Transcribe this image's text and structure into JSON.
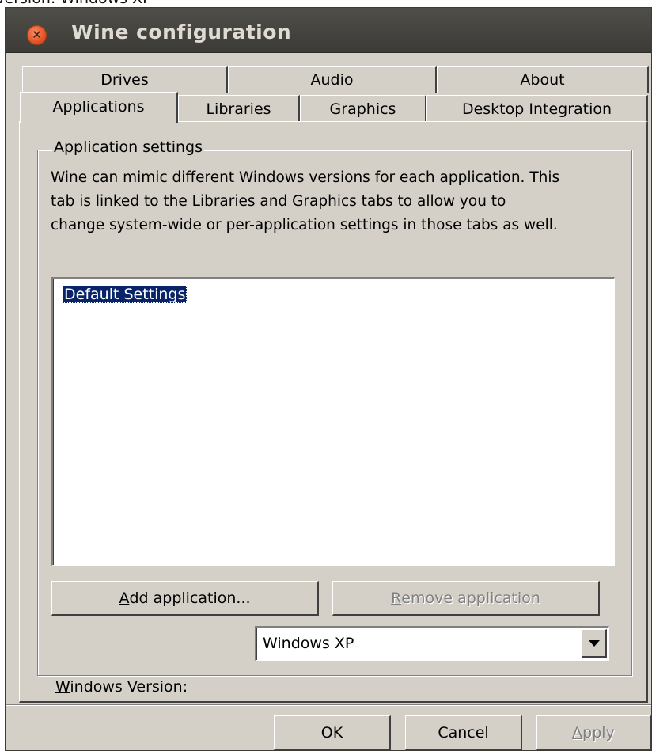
{
  "background_text": "Version: Windows XP",
  "window": {
    "title": "Wine configuration"
  },
  "tabs": {
    "row_back": [
      {
        "label": "Drives"
      },
      {
        "label": "Audio"
      },
      {
        "label": "About"
      }
    ],
    "row_front": [
      {
        "label": "Applications",
        "selected": true
      },
      {
        "label": "Libraries"
      },
      {
        "label": "Graphics"
      },
      {
        "label": "Desktop Integration"
      }
    ]
  },
  "app_settings": {
    "group_label": "Application settings",
    "description_lines": [
      "Wine can mimic different Windows versions for each application.  This",
      "tab is linked to the Libraries and Graphics tabs to allow you to",
      "change system-wide or per-application settings in those tabs as well."
    ],
    "applications": [
      {
        "name": "Default Settings",
        "selected": true
      }
    ],
    "add_button": {
      "label_pre": "",
      "mnemonic": "A",
      "label_post": "dd application..."
    },
    "remove_button": {
      "label_pre": "",
      "mnemonic": "R",
      "label_post": "emove application",
      "disabled": true
    },
    "windows_version": {
      "label_mnemonic": "W",
      "label_post": "indows Version:",
      "value": "Windows XP"
    }
  },
  "footer": {
    "ok_label": "OK",
    "cancel_label": "Cancel",
    "apply_label_pre": "",
    "apply_mnemonic": "A",
    "apply_label_post": "pply"
  },
  "colors": {
    "dialog_bg": "#d4d0c8",
    "titlebar": "#3c3b37",
    "selection": "#0a246a",
    "close_button": "#df4a1a"
  },
  "icons": {
    "close": "close-icon",
    "dropdown": "chevron-down-icon"
  }
}
